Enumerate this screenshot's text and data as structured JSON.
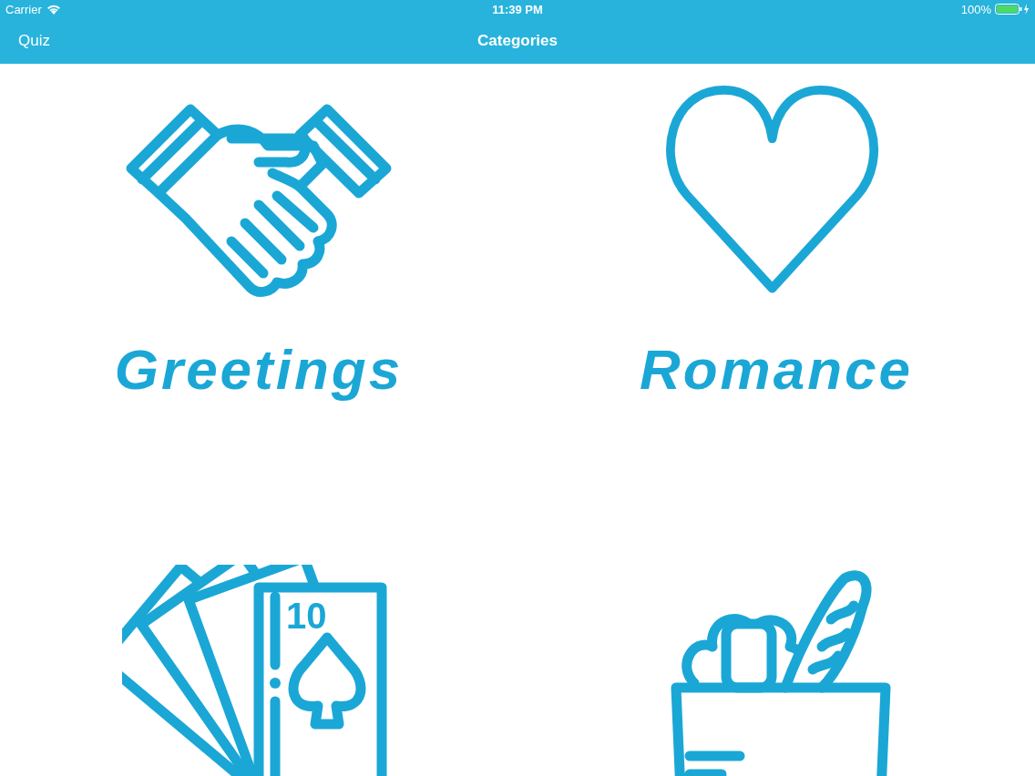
{
  "status_bar": {
    "carrier": "Carrier",
    "time": "11:39 PM",
    "battery": "100%"
  },
  "nav_bar": {
    "back": "Quiz",
    "title": "Categories"
  },
  "categories": [
    {
      "kind": "handshake",
      "label": "Greetings"
    },
    {
      "kind": "heart",
      "label": "Romance"
    },
    {
      "kind": "cards",
      "card_rank": "10"
    },
    {
      "kind": "groceries"
    }
  ]
}
